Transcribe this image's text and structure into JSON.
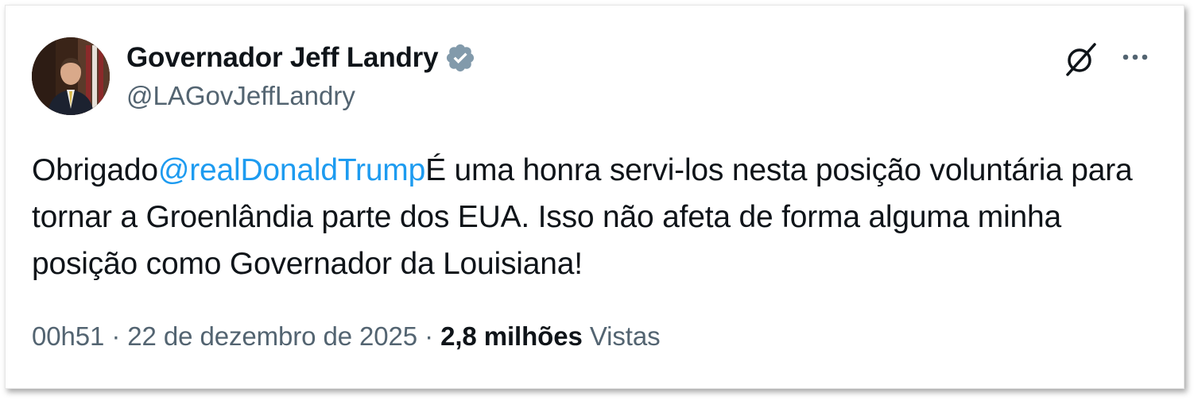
{
  "author": {
    "display_name": "Governador Jeff Landry",
    "handle": "@LAGovJeffLandry",
    "verified": true,
    "verified_color": "#829aab"
  },
  "actions": {
    "grok_icon": "grok-icon",
    "more_icon": "more-icon",
    "more_label": "···"
  },
  "tweet": {
    "text_before": "Obrigado",
    "mention": "@realDonaldTrump",
    "text_after": "É uma honra servi-los nesta posição voluntária para tornar a Groenlândia parte dos EUA. Isso não afeta de forma alguma minha posição como Governador da Louisiana!",
    "mention_color": "#1d9bf0"
  },
  "meta": {
    "time": "00h51",
    "separator1": " · ",
    "date": "22 de dezembro de 2025",
    "separator2": " · ",
    "views_count": "2,8 milhões",
    "views_label": "Vistas"
  }
}
